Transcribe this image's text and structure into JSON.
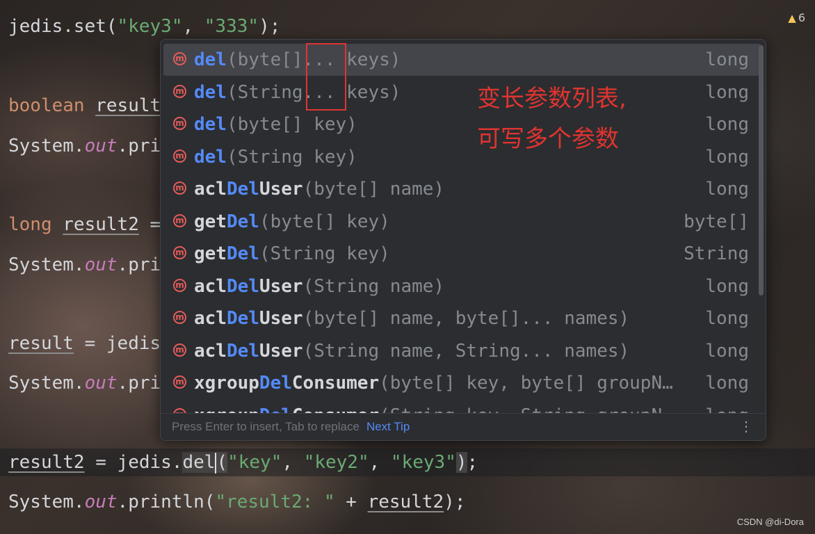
{
  "editor": {
    "line1": {
      "a": "jedis.set(",
      "s1": "\"key3\"",
      "b": ", ",
      "s2": "\"333\"",
      "c": ");"
    },
    "line2": {
      "kw": "boolean",
      "var": "result",
      "rest": ""
    },
    "line3": {
      "a": "System.",
      "fld": "out",
      "b": ".pri"
    },
    "line4": {
      "kw": "long",
      "var": "result2",
      "rest": " ="
    },
    "line5": {
      "a": "System.",
      "fld": "out",
      "b": ".pri"
    },
    "line6": {
      "var": "result",
      "rest": " = jedis"
    },
    "line7": {
      "a": "System.",
      "fld": "out",
      "b": ".pri"
    },
    "line8": {
      "var": "result2",
      "a": " = jedis.",
      "method": "del",
      "paren": "(",
      "s1": "\"key\"",
      "b": ", ",
      "s2": "\"key2\"",
      "c": ", ",
      "s3": "\"key3\"",
      "close": ")",
      "end": ";"
    },
    "line9": {
      "a": "System.",
      "fld": "out",
      "b": ".println(",
      "s1": "\"result2: \"",
      "c": " + ",
      "var": "result2",
      "d": ");"
    },
    "warning_count": "6"
  },
  "completion": {
    "items": [
      {
        "match": "del",
        "rest_name": "",
        "params": "(byte[]... keys)",
        "type": "long",
        "selected": true
      },
      {
        "match": "del",
        "rest_name": "",
        "params": "(String... keys)",
        "type": "long"
      },
      {
        "match": "del",
        "rest_name": "",
        "params": "(byte[] key)",
        "type": "long"
      },
      {
        "match": "del",
        "rest_name": "",
        "params": "(String key)",
        "type": "long"
      },
      {
        "pre": "acl",
        "match": "Del",
        "rest_name": "User",
        "params": "(byte[] name)",
        "type": "long"
      },
      {
        "pre": "get",
        "match": "Del",
        "rest_name": "",
        "params": "(byte[] key)",
        "type": "byte[]"
      },
      {
        "pre": "get",
        "match": "Del",
        "rest_name": "",
        "params": "(String key)",
        "type": "String"
      },
      {
        "pre": "acl",
        "match": "Del",
        "rest_name": "User",
        "params": "(String name)",
        "type": "long"
      },
      {
        "pre": "acl",
        "match": "Del",
        "rest_name": "User",
        "params": "(byte[] name, byte[]... names)",
        "type": "long"
      },
      {
        "pre": "acl",
        "match": "Del",
        "rest_name": "User",
        "params": "(String name, String... names)",
        "type": "long"
      },
      {
        "pre": "xgroup",
        "match": "Del",
        "rest_name": "Consumer",
        "params": "(byte[] key, byte[] groupN…",
        "type": "long"
      },
      {
        "pre": "xgroup",
        "match": "Del",
        "rest_name": "Consumer",
        "params": "(String key, String groupN…",
        "type": "long"
      }
    ],
    "footer_hint": "Press Enter to insert, Tab to replace",
    "footer_link": "Next Tip",
    "icon_letter": "m"
  },
  "annotation": {
    "line1": "变长参数列表,",
    "line2": "可写多个参数"
  },
  "watermark": "CSDN @di-Dora",
  "colors": {
    "accent": "#548af7",
    "annotation": "#e0342f",
    "method_icon": "#e55b5b"
  }
}
